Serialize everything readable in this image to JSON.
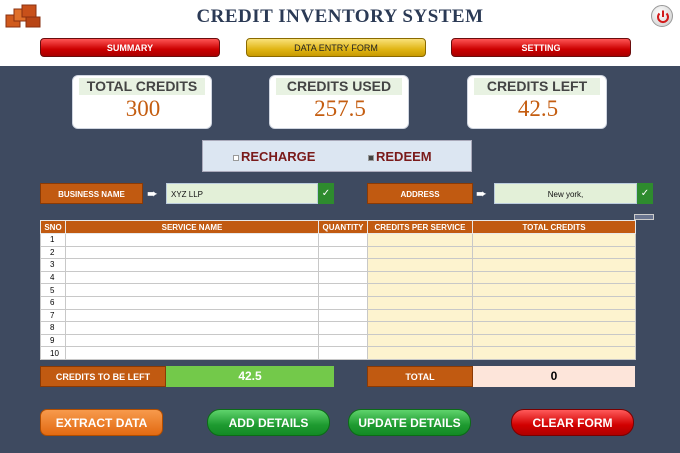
{
  "app": {
    "title": "CREDIT INVENTORY SYSTEM"
  },
  "nav": {
    "summary": "SUMMARY",
    "data_entry": "DATA ENTRY FORM",
    "setting": "SETTING"
  },
  "cards": {
    "total_credits": {
      "label": "TOTAL CREDITS",
      "value": "300"
    },
    "credits_used": {
      "label": "CREDITS USED",
      "value": "257.5"
    },
    "credits_left": {
      "label": "CREDITS LEFT",
      "value": "42.5"
    }
  },
  "mode": {
    "recharge": "RECHARGE",
    "redeem": "REDEEM",
    "selected": "REDEEM"
  },
  "form": {
    "business_name_label": "BUSINESS NAME",
    "business_name_value": "XYZ LLP",
    "address_label": "ADDRESS",
    "address_value": "New york,",
    "check_symbol": "✓"
  },
  "table": {
    "headers": [
      "SNO",
      "SERVICE NAME",
      "QUANTITY",
      "CREDITS PER SERVICE",
      "TOTAL CREDITS"
    ],
    "rows": [
      "1",
      "2",
      "3",
      "4",
      "5",
      "6",
      "7",
      "8",
      "9",
      "10"
    ]
  },
  "totals": {
    "credits_left_label": "CREDITS TO BE LEFT",
    "credits_left_value": "42.5",
    "total_label": "TOTAL",
    "total_value": "0"
  },
  "buttons": {
    "extract": "EXTRACT DATA",
    "add": "ADD DETAILS",
    "update": "UPDATE DETAILS",
    "clear": "CLEAR FORM"
  },
  "colors": {
    "background": "#3e4a60",
    "label_orange": "#c15a11",
    "value_orange": "#c45d10",
    "green_value": "#73c94a",
    "total_bg": "#fde5da"
  },
  "icons": {
    "logo": "credit-stack-logo-icon",
    "power": "power-icon",
    "arrow": "➨"
  }
}
